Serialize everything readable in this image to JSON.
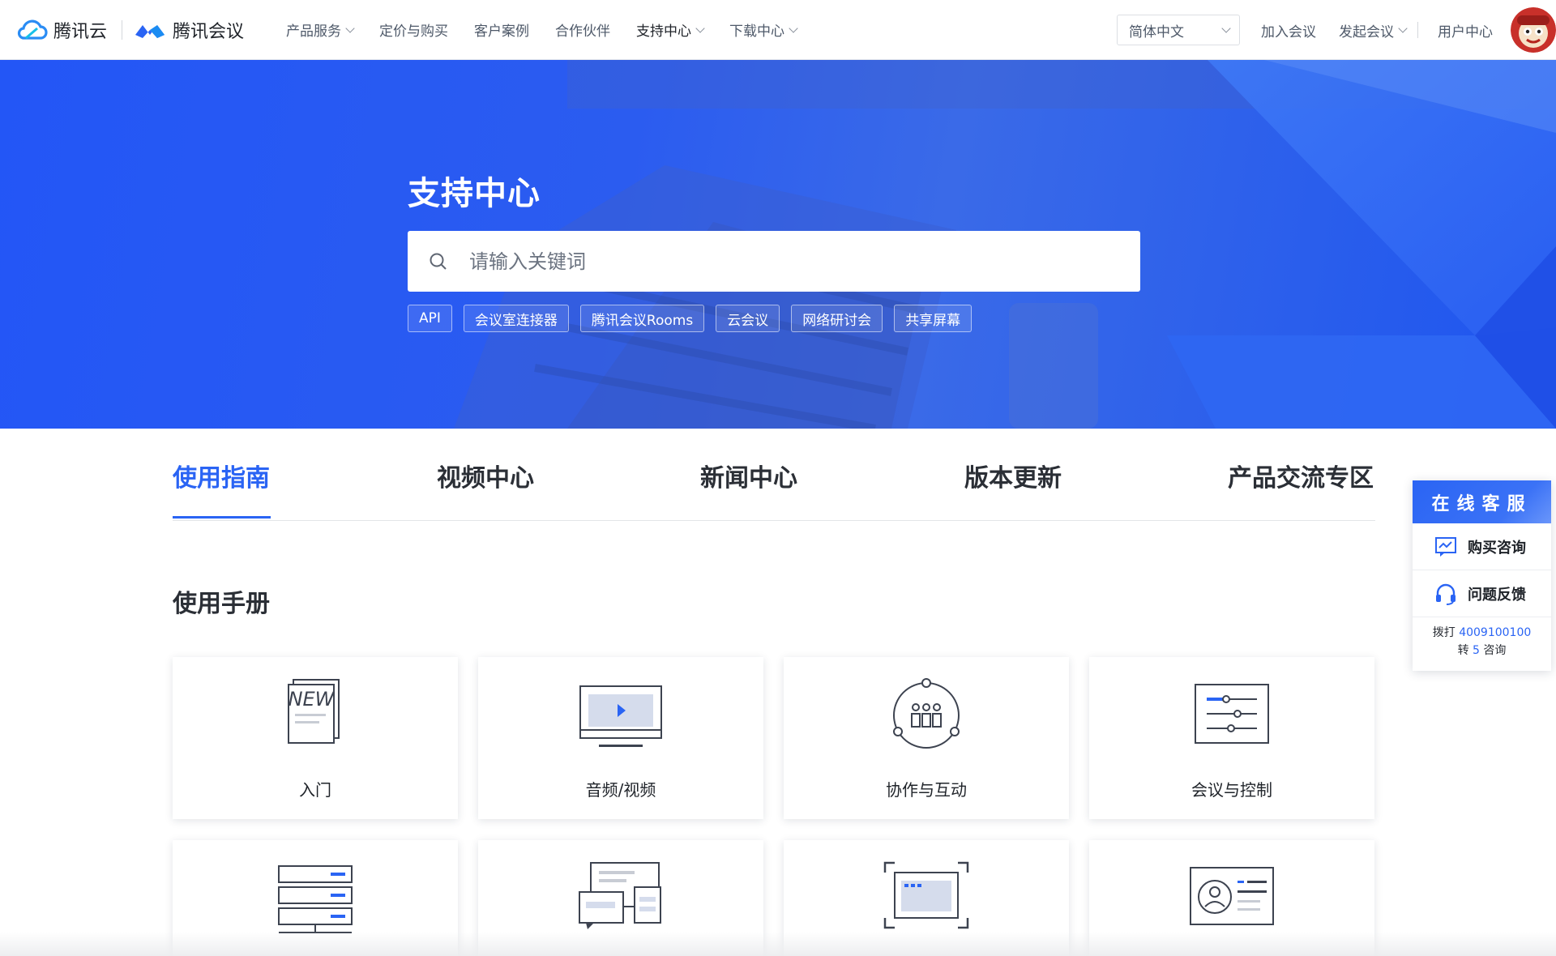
{
  "header": {
    "brand_tencent_cloud": "腾讯云",
    "brand_meeting": "腾讯会议",
    "nav": [
      {
        "label": "产品服务",
        "has_dropdown": true
      },
      {
        "label": "定价与购买",
        "has_dropdown": false
      },
      {
        "label": "客户案例",
        "has_dropdown": false
      },
      {
        "label": "合作伙伴",
        "has_dropdown": false
      },
      {
        "label": "支持中心",
        "has_dropdown": true
      },
      {
        "label": "下载中心",
        "has_dropdown": true
      }
    ],
    "language": "简体中文",
    "join_meeting": "加入会议",
    "start_meeting": "发起会议",
    "user_center": "用户中心"
  },
  "hero": {
    "title": "支持中心",
    "search_placeholder": "请输入关键词",
    "tags": [
      "API",
      "会议室连接器",
      "腾讯会议Rooms",
      "云会议",
      "网络研讨会",
      "共享屏幕"
    ]
  },
  "tabs": [
    {
      "label": "使用指南",
      "active": true
    },
    {
      "label": "视频中心",
      "active": false
    },
    {
      "label": "新闻中心",
      "active": false
    },
    {
      "label": "版本更新",
      "active": false
    },
    {
      "label": "产品交流专区",
      "active": false
    }
  ],
  "manual": {
    "title": "使用手册",
    "cards": [
      {
        "label": "入门",
        "icon": "new-document-icon"
      },
      {
        "label": "音频/视频",
        "icon": "video-monitor-icon"
      },
      {
        "label": "协作与互动",
        "icon": "collaboration-icon"
      },
      {
        "label": "会议与控制",
        "icon": "meeting-control-icon"
      },
      {
        "label": "",
        "icon": "server-list-icon"
      },
      {
        "label": "",
        "icon": "chat-windows-icon"
      },
      {
        "label": "",
        "icon": "screen-capture-icon"
      },
      {
        "label": "",
        "icon": "id-card-icon"
      }
    ]
  },
  "service": {
    "title": "在线客服",
    "purchase": "购买咨询",
    "feedback": "问题反馈",
    "call_prefix": "拨打",
    "phone": "4009100100",
    "ext_prefix": "转",
    "ext": "5",
    "ext_suffix": "咨询"
  },
  "colors": {
    "accent": "#2a64f4",
    "hero_blue": "#2356f6"
  }
}
